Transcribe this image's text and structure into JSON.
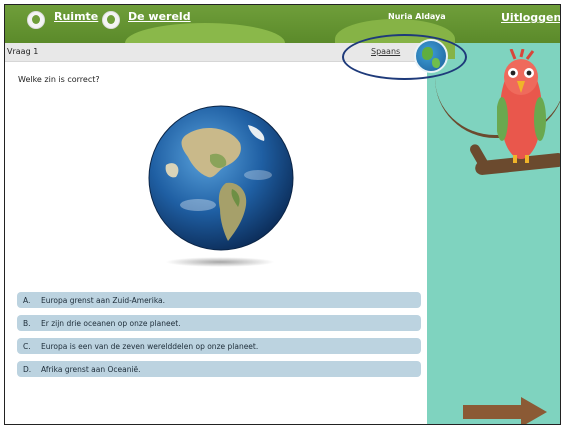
{
  "topbar": {
    "link_space": "Ruimte",
    "link_world": "De wereld",
    "user_name": "Nuria Aldaya",
    "logout": "Uitloggen"
  },
  "question": {
    "number": "Vraag 1",
    "language_link": "Spaans",
    "prompt": "Welke zin is correct?"
  },
  "answers": [
    {
      "letter": "A.",
      "text": "Europa grenst aan Zuid-Amerika."
    },
    {
      "letter": "B.",
      "text": "Er zijn drie oceanen op onze planeet."
    },
    {
      "letter": "C.",
      "text": "Europa is een van de zeven werelddelen op onze planeet."
    },
    {
      "letter": "D.",
      "text": "Afrika grenst aan Oceanië."
    }
  ],
  "colors": {
    "topbar": "#6f9e3a",
    "side_panel": "#7fd3bf",
    "answer_bg": "#bcd3e0",
    "highlight_oval": "#1e3a7a",
    "next_arrow": "#8b5a35"
  },
  "icons": {
    "nav_space": "globe-icon",
    "nav_world": "globe-icon",
    "language": "globe-icon",
    "next": "arrow-right-icon",
    "mascot": "parrot"
  }
}
